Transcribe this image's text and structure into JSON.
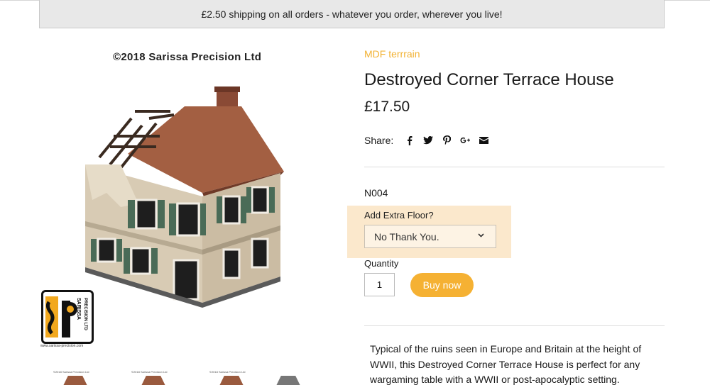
{
  "banner": {
    "text": "£2.50 shipping on all orders - whatever you order, wherever you live!"
  },
  "gallery": {
    "copyright": "©2018 Sarissa Precision Ltd",
    "logo_text_top": "SARISSA",
    "logo_text_side": "PRECISION LTD",
    "logo_url": "www.sarissa-precision.com",
    "thumb_caption": "©2018 Sarissa Precision Ltd"
  },
  "product": {
    "category": "MDF terrrain",
    "title": "Destroyed Corner Terrace House",
    "price": "£17.50",
    "share_label": "Share:",
    "share_icons": [
      "facebook-icon",
      "twitter-icon",
      "pinterest-icon",
      "google-plus-icon",
      "email-icon"
    ],
    "sku": "N004",
    "option_label": "Add Extra Floor?",
    "option_selected": "No Thank You.",
    "quantity_label": "Quantity",
    "quantity_value": "1",
    "buy_label": "Buy now",
    "description": "Typical of the ruins seen in Europe and Britain at the height of WWII, this Destroyed Corner Terrace House is perfect for any wargaming table with a WWII or post-apocalyptic setting."
  },
  "colors": {
    "accent": "#f5b133",
    "category": "#f2b233",
    "option_bg": "#fbe8cc"
  }
}
